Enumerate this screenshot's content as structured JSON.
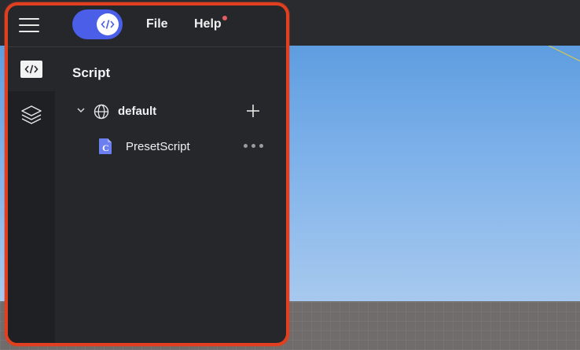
{
  "colors": {
    "accent": "#4a5ee8",
    "panel_bg": "#26272b",
    "rail_bg": "#1f2023",
    "highlight_border": "#e0401f",
    "notification": "#e85c62",
    "sky_top": "#5e9de0",
    "sky_bottom": "#a7c9ee",
    "ground": "#6f6c6b"
  },
  "header": {
    "menu_icon": "hamburger-menu-icon",
    "toggle_icon": "code-icon",
    "toggle_state": "on",
    "menus": [
      {
        "label": "File"
      },
      {
        "label": "Help",
        "has_notification": true
      }
    ]
  },
  "left_rail": {
    "items": [
      {
        "icon": "code-editor-icon",
        "active": true
      },
      {
        "icon": "layers-icon",
        "active": false
      }
    ]
  },
  "script_panel": {
    "title": "Script",
    "tree": [
      {
        "label": "default",
        "icon": "globe-icon",
        "expanded": true,
        "action_icon": "plus-icon",
        "children": [
          {
            "label": "PresetScript",
            "icon": "script-file-icon",
            "action_icon": "more-icon"
          }
        ]
      }
    ]
  }
}
